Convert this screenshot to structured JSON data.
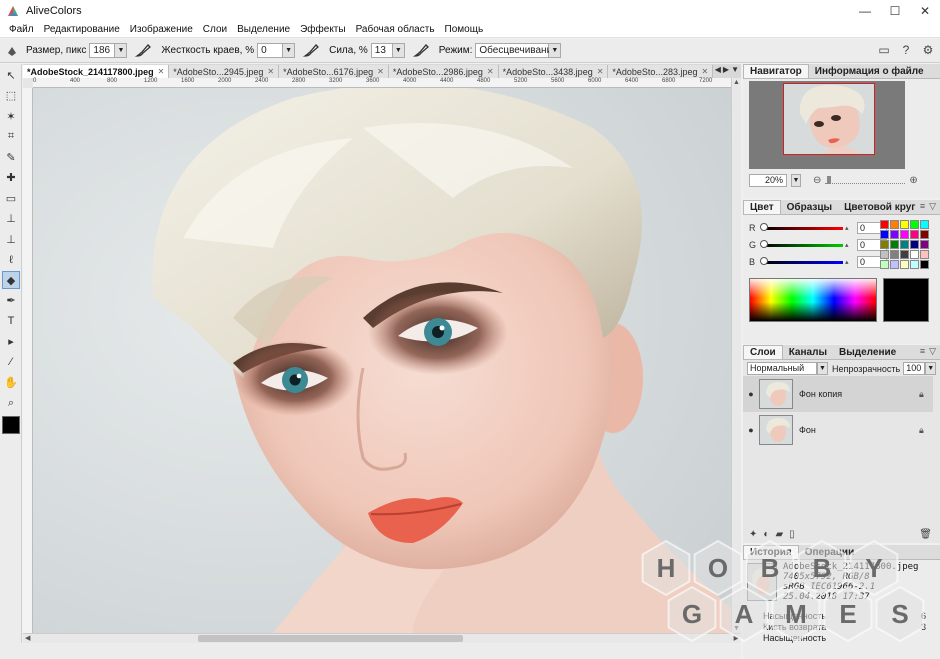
{
  "window": {
    "title": "AliveColors",
    "min_label": "—",
    "max_label": "☐",
    "close_label": "✕"
  },
  "menu": [
    "Файл",
    "Редактирование",
    "Изображение",
    "Слои",
    "Выделение",
    "Эффекты",
    "Рабочая область",
    "Помощь"
  ],
  "options": {
    "size_label": "Размер, пикс",
    "size_value": "186",
    "hardness_label": "Жесткость краев, %",
    "hardness_value": "0",
    "strength_label": "Сила, %",
    "strength_value": "13",
    "mode_label": "Режим:",
    "mode_value": "Обесцвечивание"
  },
  "doc_tabs": [
    {
      "label": "*AdobeStock_214117800.jpeg",
      "active": true
    },
    {
      "label": "*AdobeSto...2945.jpeg",
      "active": false
    },
    {
      "label": "*AdobeSto...6176.jpeg",
      "active": false
    },
    {
      "label": "*AdobeSto...2986.jpeg",
      "active": false
    },
    {
      "label": "*AdobeSto...3438.jpeg",
      "active": false
    },
    {
      "label": "*AdobeSto...283.jpeg",
      "active": false
    }
  ],
  "ruler_labels": [
    "0",
    "400",
    "800",
    "1200",
    "1600",
    "2000",
    "2400",
    "2800",
    "3200",
    "3600",
    "4000",
    "4400",
    "4800",
    "5200",
    "5600",
    "6000",
    "6400",
    "6800",
    "7200"
  ],
  "navigator": {
    "tabs": [
      "Навигатор",
      "Информация о файле"
    ],
    "zoom": "20%"
  },
  "color_panel": {
    "tabs": [
      "Цвет",
      "Образцы",
      "Цветовой круг"
    ],
    "channels": [
      {
        "name": "R",
        "value": "0",
        "color": "#d01010"
      },
      {
        "name": "G",
        "value": "0",
        "color": "#10a010"
      },
      {
        "name": "B",
        "value": "0",
        "color": "#1030d0"
      }
    ],
    "swatches": [
      "#ff0000",
      "#ff8000",
      "#ffff00",
      "#00ff00",
      "#00ffff",
      "#0000ff",
      "#8000ff",
      "#ff00ff",
      "#ff0080",
      "#800000",
      "#808000",
      "#008000",
      "#008080",
      "#000080",
      "#800080",
      "#c0c0c0",
      "#808080",
      "#404040",
      "#ffffff",
      "#ffc0c0",
      "#c0ffc0",
      "#c0c0ff",
      "#ffffc0",
      "#c0ffff",
      "#000000"
    ],
    "current_color": "#000000"
  },
  "layers": {
    "tabs": [
      "Слои",
      "Каналы",
      "Выделение"
    ],
    "blend_mode": "Нормальный",
    "opacity_label": "Непрозрачность",
    "opacity_value": "100",
    "items": [
      {
        "name": "Фон копия",
        "selected": true
      },
      {
        "name": "Фон",
        "selected": false
      }
    ]
  },
  "history": {
    "tabs": [
      "История",
      "Операции"
    ],
    "file_name": "AdobeStock_214117800.jpeg",
    "dims": "7405x5792, RGB/8",
    "profile": "sRGB IEC61966-2.1",
    "date": "25.04.2018 17:37",
    "entries": [
      {
        "name": "Насыщенность",
        "count": "6"
      },
      {
        "name": "Кисть возврата",
        "count": "3"
      },
      {
        "name": "Насыщенность",
        "count": ""
      }
    ]
  },
  "watermark": [
    "H",
    "O",
    "B",
    "B",
    "Y",
    "G",
    "A",
    "M",
    "E",
    "S"
  ],
  "icons": {
    "app": "alivecolors-logo-icon",
    "tools": [
      "move-icon",
      "marquee-icon",
      "magic-wand-icon",
      "crop-icon",
      "brush-icon",
      "healing-icon",
      "gradient-icon",
      "clone-stamp-icon",
      "stamp-icon",
      "lasso-icon",
      "sponge-icon",
      "pen-icon",
      "text-icon",
      "path-select-icon",
      "eyedropper-icon",
      "hand-icon",
      "zoom-icon"
    ]
  }
}
